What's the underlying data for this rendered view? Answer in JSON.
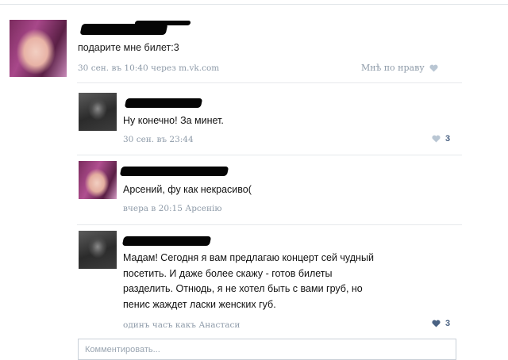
{
  "post": {
    "text": "подарите мне билет:3",
    "meta_time": "30 сен. въ 10:40",
    "meta_via": "через m.vk.com",
    "like_label": "Мнѣ по нраву"
  },
  "comments": [
    {
      "text": "Ну конечно! За минет.",
      "meta": "30 сен. въ 23:44",
      "likes": "3"
    },
    {
      "text": "Арсений, фу как некрасиво(",
      "meta_time": "вчера в 20:15",
      "meta_reply_to": "Арсенію"
    },
    {
      "lines": [
        "Мадам! Сегодня я вам предлагаю концерт сей чудный",
        "посетить. И даже более скажу - готов билеты",
        "разделить. Отнюдь, я не хотел быть с вами груб, но",
        "пенис жаждет ласки женских губ."
      ],
      "meta_time": "одинъ часъ",
      "meta_reply_to": "какъ Анастаси",
      "likes": "3"
    }
  ],
  "compose": {
    "placeholder": "Комментировать..."
  },
  "colors": {
    "meta": "#8d9aa8",
    "like_active": "#4a6283",
    "heart_inactive": "#b9c6d3"
  },
  "icons": {
    "like": "heart-icon"
  }
}
